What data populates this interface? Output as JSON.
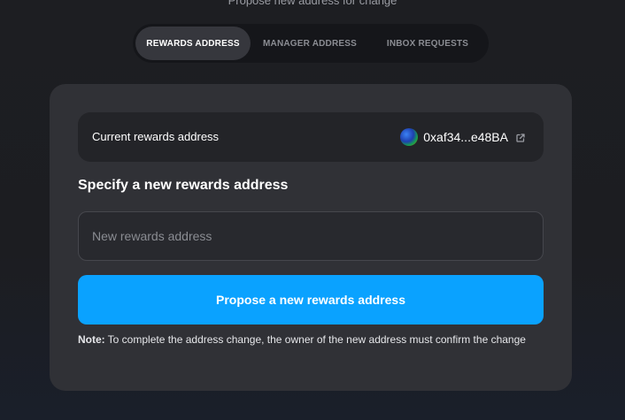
{
  "header": {
    "subtitle": "Propose new address for change"
  },
  "tabs": [
    {
      "label": "REWARDS ADDRESS",
      "active": true
    },
    {
      "label": "MANAGER ADDRESS",
      "active": false
    },
    {
      "label": "INBOX REQUESTS",
      "active": false
    }
  ],
  "current": {
    "label": "Current rewards address",
    "address": "0xaf34...e48BA",
    "icon": "external-link-icon"
  },
  "form": {
    "heading": "Specify a new rewards address",
    "input_placeholder": "New rewards address",
    "input_value": "",
    "button_label": "Propose a new rewards address"
  },
  "note": {
    "label": "Note:",
    "text": "To complete the address change, the owner of the new address must confirm the change"
  },
  "colors": {
    "accent": "#0aa2ff",
    "card": "#303136",
    "background": "#1d1e22"
  }
}
